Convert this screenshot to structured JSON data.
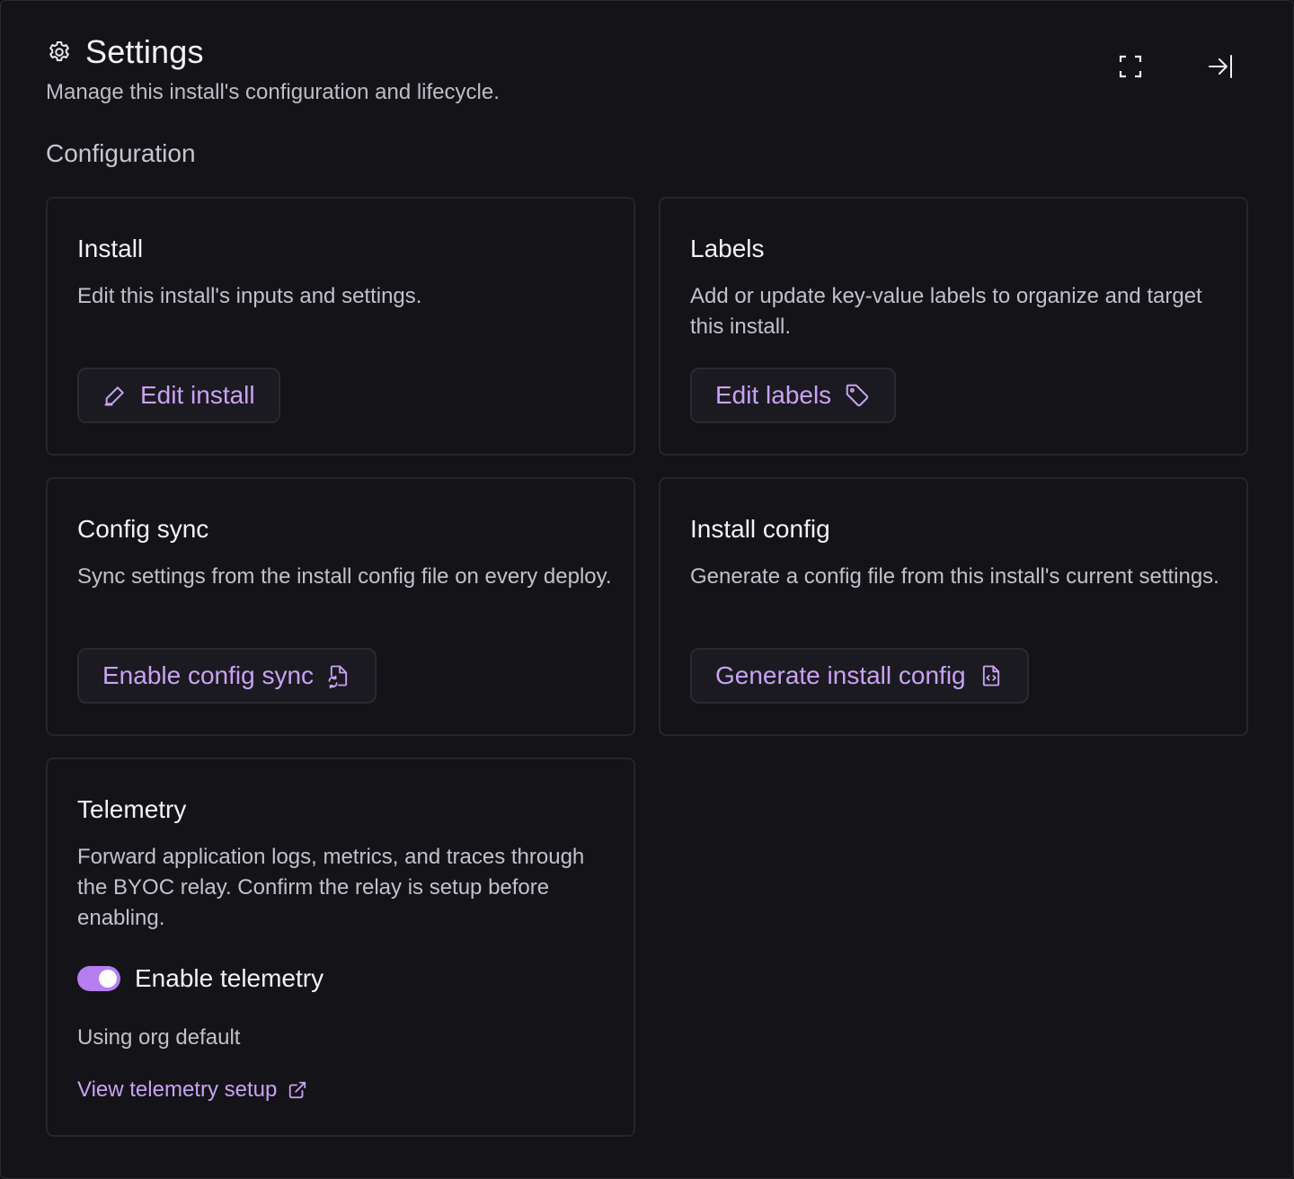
{
  "header": {
    "title": "Settings",
    "subtitle": "Manage this install's configuration and lifecycle.",
    "actions": [
      {
        "icon": "expand-icon"
      },
      {
        "icon": "collapse-panel-icon"
      }
    ]
  },
  "section": {
    "title": "Configuration"
  },
  "cards": {
    "install": {
      "title": "Install",
      "description": "Edit this install's inputs and settings.",
      "button_label": "Edit install",
      "button_icon": "pencil-icon"
    },
    "labels": {
      "title": "Labels",
      "description": "Add or update key-value labels to organize and target this install.",
      "button_label": "Edit labels",
      "button_icon": "tag-icon"
    },
    "config_sync": {
      "title": "Config sync",
      "description": "Sync settings from the install config file on every deploy.",
      "button_label": "Enable config sync",
      "button_icon": "file-sync-icon"
    },
    "install_config": {
      "title": "Install config",
      "description": "Generate a config file from this install's current settings.",
      "button_label": "Generate install config",
      "button_icon": "file-code-icon"
    },
    "telemetry": {
      "title": "Telemetry",
      "description": "Forward application logs, metrics, and traces through the BYOC relay. Confirm the relay is setup before enabling.",
      "toggle_label": "Enable telemetry",
      "toggle_on": true,
      "status": "Using org default",
      "link_label": "View telemetry setup",
      "link_icon": "external-link-icon"
    }
  },
  "colors": {
    "background": "#141318",
    "accent": "#c9a2f5",
    "toggle_on": "#b57ef0",
    "border": "#26252c"
  }
}
